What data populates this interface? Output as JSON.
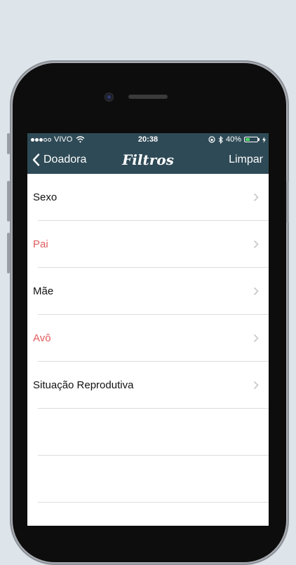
{
  "status_bar": {
    "carrier": "VIVO",
    "signal_bars": [
      true,
      true,
      true,
      false,
      false
    ],
    "time": "20:38",
    "battery_percent": "40%",
    "battery_level": 0.4,
    "icons": [
      "wifi-icon",
      "orientation-lock-icon",
      "bluetooth-icon",
      "battery-icon",
      "charging-bolt-icon"
    ]
  },
  "nav": {
    "back_label": "Doadora",
    "title": "Filtros",
    "right_label": "Limpar"
  },
  "filters": [
    {
      "label": "Sexo",
      "color": "#111111"
    },
    {
      "label": "Pai",
      "color": "#e05c5c"
    },
    {
      "label": "Mãe",
      "color": "#111111"
    },
    {
      "label": "Avô",
      "color": "#e05c5c"
    },
    {
      "label": "Situação Reprodutiva",
      "color": "#111111"
    }
  ],
  "colors": {
    "bar_background": "#2e4a56",
    "accent_red": "#e05c5c",
    "page_background": "#dde5ea"
  }
}
